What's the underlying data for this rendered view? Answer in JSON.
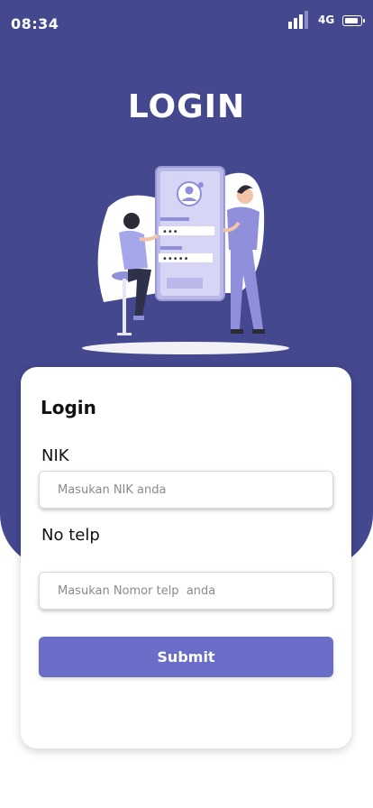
{
  "status_bar": {
    "time": "08:34",
    "network": "4G",
    "icons": [
      "signal-icon",
      "battery-icon"
    ]
  },
  "header": {
    "title": "LOGIN"
  },
  "illustration": {
    "name": "login-illustration",
    "dots_field_1": "•••",
    "dots_field_2": "•••••"
  },
  "form": {
    "title": "Login",
    "nik_label": "NIK",
    "nik_placeholder": "Masukan NIK anda",
    "phone_label": "No telp",
    "phone_placeholder": "Masukan Nomor telp  anda",
    "submit_label": "Submit"
  },
  "colors": {
    "primary": "#43488f",
    "button": "#6a6ec8",
    "illustration_accent": "#8f8fdc"
  }
}
